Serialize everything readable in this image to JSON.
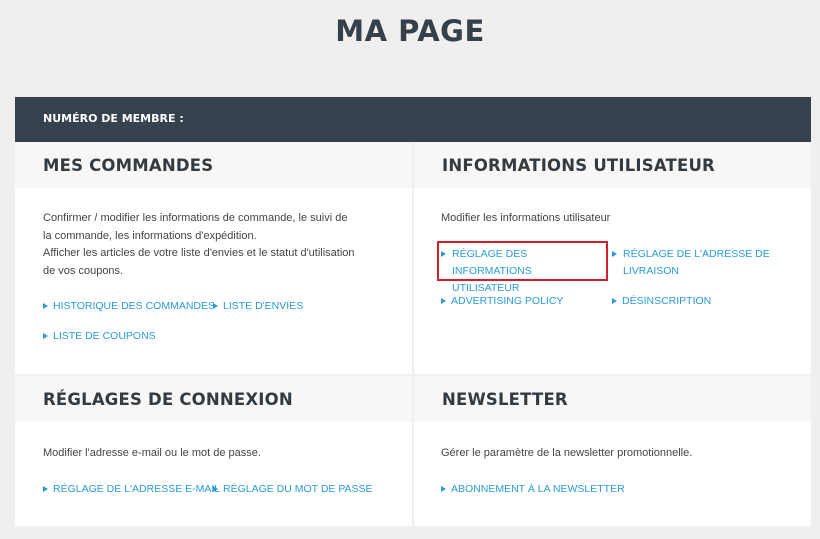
{
  "page_title": "MA PAGE",
  "member_bar": {
    "label": "NUMÉRO DE MEMBRE :"
  },
  "orders": {
    "title": "MES COMMANDES",
    "desc_line1": "Confirmer / modifier les informations de commande, le suivi de",
    "desc_line2": "la commande, les informations d'expédition.",
    "desc_line3": "Afficher les articles de votre liste d'envies et le statut d'utilisation",
    "desc_line4": "de vos coupons.",
    "links": {
      "history": "HISTORIQUE DES COMMANDES",
      "wishlist": "LISTE D'ENVIES",
      "coupons": "LISTE DE COUPONS"
    }
  },
  "user_info": {
    "title": "INFORMATIONS UTILISATEUR",
    "desc": "Modifier les informations utilisateur",
    "links": {
      "settings_line1": "RÉGLAGE DES INFORMATIONS",
      "settings_line2": "UTILISATEUR",
      "address_line1": "RÉGLAGE DE L'ADRESSE DE",
      "address_line2": "LIVRAISON",
      "advertising": "ADVERTISING POLICY",
      "unsubscribe": "DÉSINSCRIPTION"
    }
  },
  "login": {
    "title": "RÉGLAGES DE CONNEXION",
    "desc": "Modifier l'adresse e-mail ou le mot de passe.",
    "links": {
      "email": "RÉGLAGE DE L'ADRESSE E-MAIL",
      "password": "RÉGLAGE DU MOT DE PASSE"
    }
  },
  "newsletter": {
    "title": "NEWSLETTER",
    "desc": "Gérer le paramètre de la newsletter promotionnelle.",
    "links": {
      "subscribe": "ABONNEMENT À LA NEWSLETTER"
    }
  },
  "colors": {
    "accent_link": "#2a9bd6",
    "header_bar": "#36424e",
    "highlight_border": "#d21f2a"
  }
}
